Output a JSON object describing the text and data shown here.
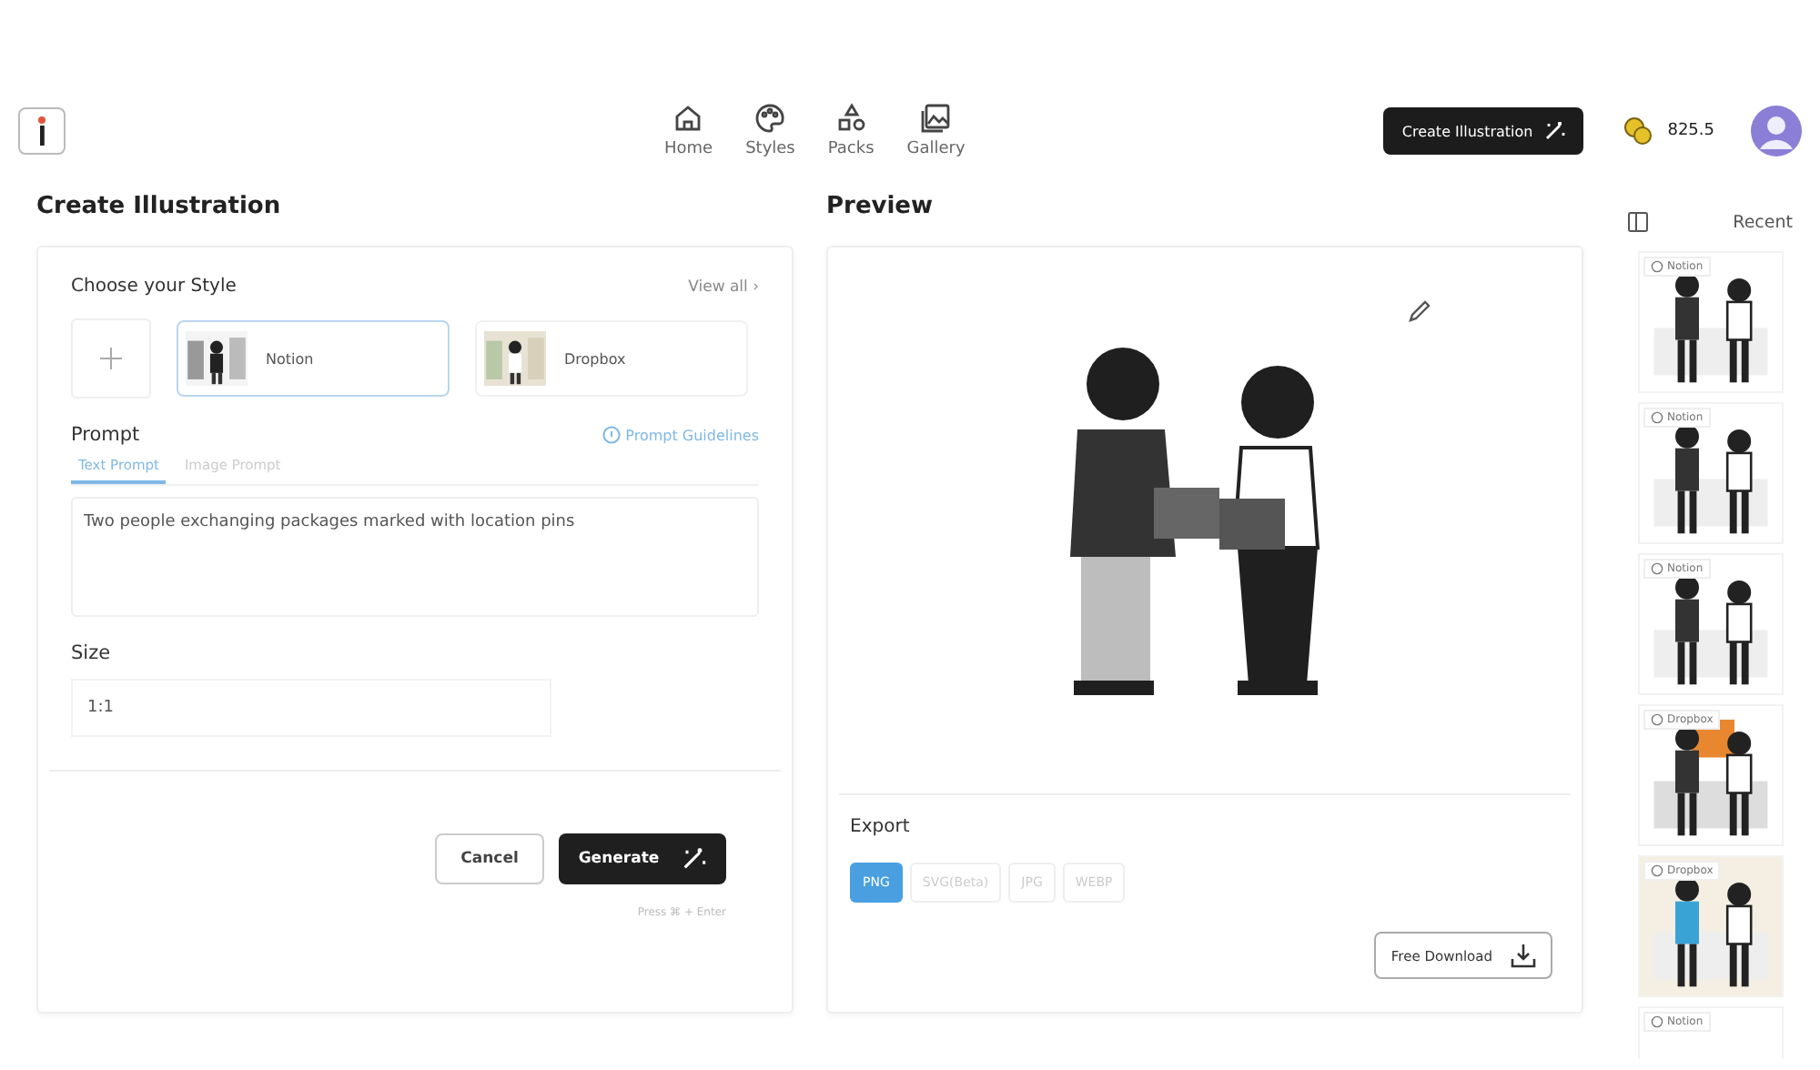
{
  "nav": [
    {
      "label": "Home",
      "selected": false
    },
    {
      "label": "Styles",
      "selected": false
    },
    {
      "label": "Packs",
      "selected": false
    },
    {
      "label": "Gallery",
      "selected": false
    }
  ],
  "header": {
    "cta": "Create Illustration",
    "credits": "825.5"
  },
  "create": {
    "title": "Create Illustration",
    "style_label": "Choose your Style",
    "view_all": "View all ›",
    "styles": [
      {
        "name": "Notion",
        "selected": true
      },
      {
        "name": "Dropbox",
        "selected": false
      }
    ],
    "prompt_label": "Prompt",
    "guidelines": "Prompt Guidelines",
    "prompt_tabs": [
      {
        "label": "Text Prompt",
        "selected": true
      },
      {
        "label": "Image Prompt",
        "selected": false
      }
    ],
    "prompt_value": "Two people exchanging packages marked with location pins",
    "size_label": "Size",
    "size_value": "1:1",
    "cancel": "Cancel",
    "generate": "Generate",
    "hint": "Press ⌘ + Enter"
  },
  "preview": {
    "title": "Preview",
    "export_label": "Export",
    "formats": [
      {
        "label": "PNG",
        "selected": true
      },
      {
        "label": "SVG(Beta)",
        "selected": false
      },
      {
        "label": "JPG",
        "selected": false
      },
      {
        "label": "WEBP",
        "selected": false
      }
    ],
    "download": "Free Download"
  },
  "recent": {
    "title": "Recent",
    "items": [
      {
        "style": "Notion"
      },
      {
        "style": "Notion"
      },
      {
        "style": "Notion"
      },
      {
        "style": "Dropbox"
      },
      {
        "style": "Dropbox"
      },
      {
        "style": "Notion"
      }
    ]
  }
}
